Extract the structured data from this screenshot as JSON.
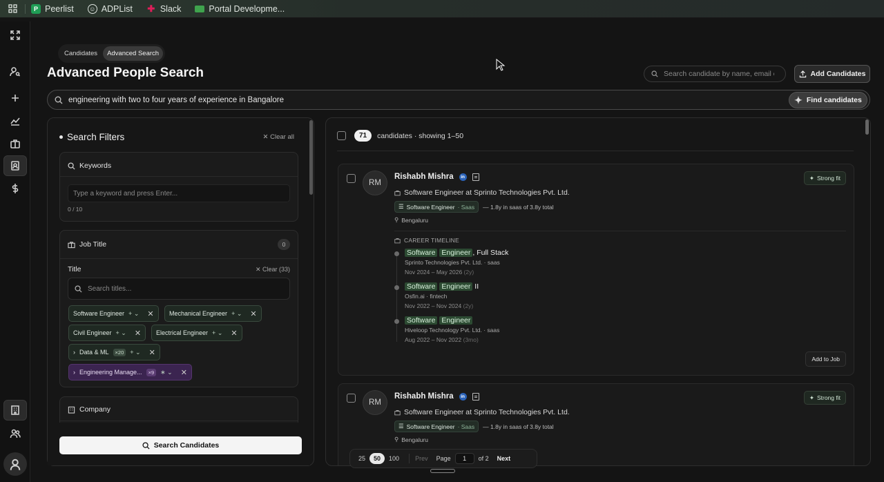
{
  "bookmarks": {
    "items": [
      {
        "label": "Peerlist",
        "icon": "peerlist-icon"
      },
      {
        "label": "ADPList",
        "icon": "adplist-icon"
      },
      {
        "label": "Slack",
        "icon": "slack-icon"
      },
      {
        "label": "Portal Developme...",
        "icon": "portal-icon"
      }
    ]
  },
  "breadcrumb": [
    "Candidates",
    "Advanced Search"
  ],
  "page_title": "Advanced People Search",
  "header": {
    "search_placeholder": "Search candidate by name, email o",
    "add_candidates": "Add Candidates"
  },
  "query": {
    "text": "engineering with two to four years of experience in Bangalore",
    "find_label": "Find candidates"
  },
  "filters": {
    "title": "Search Filters",
    "clear_all": "Clear all",
    "keywords": {
      "title": "Keywords",
      "placeholder": "Type a keyword and press Enter...",
      "counter": "0 / 10"
    },
    "job_title": {
      "title": "Job Title",
      "count": "0",
      "sub_label": "Title",
      "clear": "Clear (33)",
      "search_placeholder": "Search titles...",
      "chips": [
        {
          "label": "Software Engineer",
          "mode": "+"
        },
        {
          "label": "Mechanical Engineer",
          "mode": "+"
        },
        {
          "label": "Civil Engineer",
          "mode": "+"
        },
        {
          "label": "Electrical Engineer",
          "mode": "+"
        },
        {
          "label": "Data & ML",
          "mult": "×20",
          "mode": "+"
        },
        {
          "label": "Engineering Manage...",
          "mult": "×9",
          "mode": "∗"
        }
      ]
    },
    "company": {
      "title": "Company"
    },
    "search_button": "Search Candidates"
  },
  "results": {
    "total": "71",
    "summary": "candidates · showing 1–50",
    "candidates": [
      {
        "initials": "RM",
        "name": "Rishabh Mishra",
        "role": "Software Engineer at Sprinto Technologies Pvt. Ltd.",
        "tag": "Software Engineer",
        "tag_sub": "· Saas",
        "experience": "— 1.8y in saas of 3.8y total",
        "location": "Bengaluru",
        "fit": "Strong fit",
        "timeline_label": "CAREER TIMELINE",
        "timeline": [
          {
            "h1": "Software",
            "h2": "Engineer",
            "rest": ", Full Stack",
            "company": "Sprinto Technologies Pvt. Ltd. · saas",
            "dates": "Nov 2024 – May 2026",
            "dur": "(2y)"
          },
          {
            "h1": "Software",
            "h2": "Engineer",
            "rest": " II",
            "company": "Osfin.ai · fintech",
            "dates": "Nov 2022 – Nov 2024",
            "dur": "(2y)"
          },
          {
            "h1": "Software",
            "h2": "Engineer",
            "rest": "",
            "company": "Hiveloop Technology Pvt. Ltd. · saas",
            "dates": "Aug 2022 – Nov 2022",
            "dur": "(3mo)"
          }
        ],
        "add_to_job": "Add to Job"
      },
      {
        "initials": "RM",
        "name": "Rishabh Mishra",
        "role": "Software Engineer at Sprinto Technologies Pvt. Ltd.",
        "tag": "Software Engineer",
        "tag_sub": "· Saas",
        "experience": "— 1.8y in saas of 3.8y total",
        "location": "Bengaluru",
        "fit": "Strong fit"
      }
    ]
  },
  "pagination": {
    "sizes": [
      "25",
      "50",
      "100"
    ],
    "prev": "Prev",
    "page_label": "Page",
    "page": "1",
    "of": "of 2",
    "next": "Next"
  },
  "colors": {
    "background": "#141414",
    "highlight": "#2c4a32",
    "primary_button": "#f4f4f4",
    "linkedin": "#2a62b8",
    "purple_chip": "#3b2450"
  }
}
